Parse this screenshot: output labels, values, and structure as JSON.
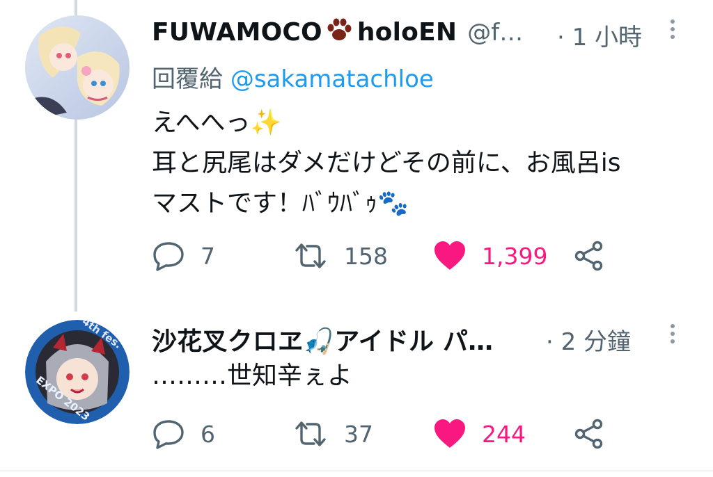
{
  "tweets": [
    {
      "author_name": "FUWAMOCO",
      "author_suffix": "holoEN",
      "handle": "@f…",
      "time": "· 1 小時",
      "reply_prefix": "回覆給",
      "reply_to": "@sakamatachloe",
      "lines": [
        "えへへっ✨",
        "耳と尻尾はダメだけどその前に、お風呂is",
        "マストです！ﾊﾞｳﾊﾞｩ🐾"
      ],
      "actions": {
        "replies": "7",
        "retweets": "158",
        "likes": "1,399"
      }
    },
    {
      "author_name": "沙花叉クロヱ🎣アイドル パ…",
      "time": "· 2 分鐘",
      "lines": [
        "………世知辛ぇよ"
      ],
      "actions": {
        "replies": "6",
        "retweets": "37",
        "likes": "244"
      }
    }
  ],
  "icons": {
    "reply": "reply-icon",
    "retweet": "retweet-icon",
    "like": "heart-icon",
    "share": "share-icon",
    "more": "more-options-icon",
    "paw": "paw-icon"
  },
  "colors": {
    "accent": "#1d9bf0",
    "like": "#f91880",
    "muted": "#536471",
    "thread_line": "#cfd9de"
  },
  "avatars": {
    "second_ring_text": [
      "4th fes.",
      "EXPO 2023"
    ]
  }
}
